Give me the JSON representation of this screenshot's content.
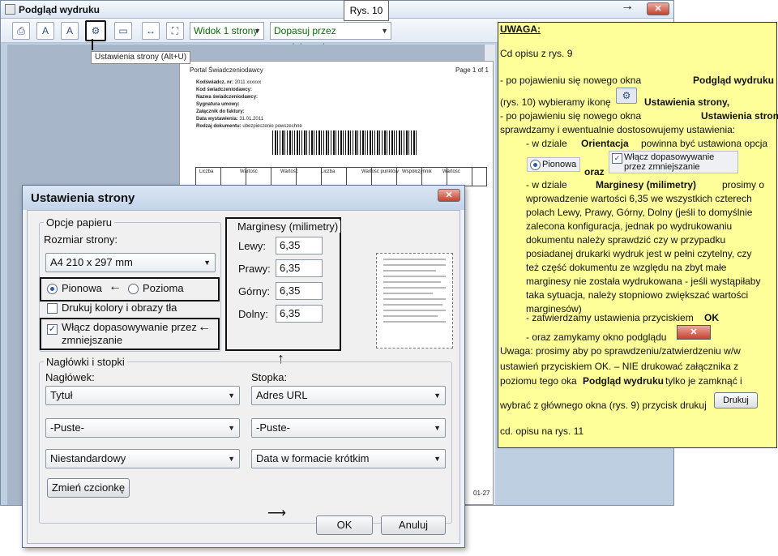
{
  "preview_window": {
    "title": "Podgląd wydruku",
    "close_glyph": "✕",
    "figure_label": "Rys. 10",
    "tooltip": "Ustawienia strony (Alt+U)",
    "toolbar": {
      "view_select": "Widok 1 strony",
      "fit_select": "Dopasuj przez zmniejszenie",
      "icons": [
        "printer-icon",
        "portrait-icon",
        "landscape-icon",
        "page-setup-icon",
        "header-footer-icon",
        "fit-width-icon",
        "fullscreen-icon"
      ]
    },
    "page": {
      "header_left": "Portal Świadczeniodawcy",
      "header_right": "Page 1 of 1",
      "fields": [
        {
          "label": "Kodświadcz. nr:",
          "value": "2011 xxxxxx"
        },
        {
          "label": "Kod świadczeniodawcy:",
          "value": ""
        },
        {
          "label": "Nazwa świadczeniodawcy:",
          "value": ""
        },
        {
          "label": "Sygnatura umowy:",
          "value": ""
        },
        {
          "label": "Załącznik do faktury:",
          "value": ""
        },
        {
          "label": "Data wystawienia:",
          "value": "31.01.2011"
        },
        {
          "label": "Rodzaj dokumentu:",
          "value": "ubezpieczenie powszechne"
        }
      ],
      "table_headers": [
        "Liczba",
        "Wartość",
        "Wartość",
        "Liczba",
        "Wartość punktów",
        "Współczynnik",
        "Wartość"
      ],
      "footer_fragment": "01-27",
      "side_values": [
        "1,00",
        "1,00",
        "1,00"
      ]
    }
  },
  "dialog": {
    "title": "Ustawienia strony",
    "close_glyph": "✕",
    "paper_options": {
      "legend": "Opcje papieru",
      "size_label": "Rozmiar strony:",
      "size_value": "A4 210 x 297 mm",
      "portrait": "Pionowa",
      "landscape": "Pozioma",
      "print_colors": "Drukuj kolory i obrazy tła",
      "shrink_to_fit_line1": "Włącz dopasowywanie przez",
      "shrink_to_fit_line2": "zmniejszanie"
    },
    "margins": {
      "legend": "Marginesy (milimetry)",
      "left_label": "Lewy:",
      "left_value": "6,35",
      "right_label": "Prawy:",
      "right_value": "6,35",
      "top_label": "Górny:",
      "top_value": "6,35",
      "bottom_label": "Dolny:",
      "bottom_value": "6,35"
    },
    "headers_footers": {
      "legend": "Nagłówki i stopki",
      "header_label": "Nagłówek:",
      "footer_label": "Stopka:",
      "header_values": [
        "Tytuł",
        "-Puste-",
        "Niestandardowy"
      ],
      "footer_values": [
        "Adres URL",
        "-Puste-",
        "Data w formacie krótkim"
      ],
      "font_button": "Zmień czcionkę"
    },
    "ok": "OK",
    "cancel": "Anuluj"
  },
  "note": {
    "heading": "UWAGA:",
    "lines": [
      "Cd opisu z rys. 9",
      "-      po pojawieniu się nowego okna",
      "Podgląd wydruku",
      "(rys. 10) wybieramy ikonę",
      "Ustawienia strony,",
      "-      po pojawieniu się nowego okna",
      "Ustawienia strony",
      "sprawdzamy i ewentualnie dostosowujemy ustawienia:",
      "- w dziale",
      "Orientacja",
      "powinna być ustawiona opcja",
      "oraz",
      "- w dziale",
      "Marginesy (milimetry)",
      "prosimy o",
      "wprowadzenie wartości 6,35 we wszystkich czterech",
      "polach Lewy, Prawy, Górny, Dolny (jeśli to domyślnie",
      "zalecona konfiguracja, jednak po wydrukowaniu",
      "dokumentu należy sprawdzić czy w przypadku",
      "posiadanej drukarki wydruk jest w pełni czytelny, czy",
      "też część dokumentu ze względu na zbyt małe",
      "marginesy nie została wydrukowana - jeśli wystąpiłaby",
      "taka sytuacja, należy stopniowo zwiększać wartości",
      "marginesów)",
      "- zatwierdzamy ustawienia przyciskiem",
      "OK",
      "- oraz zamykamy okno podglądu",
      "Uwaga: prosimy aby po sprawdzeniu/zatwierdzeniu w/w",
      "ustawień przyciskiem OK. – NIE drukować załącznika z",
      "poziomu tego oka",
      "Podgląd wydruku",
      "tylko je zamknąć i",
      "wybrać z głównego okna (rys. 9) przycisk drukuj",
      "cd. opisu na rys. 11"
    ],
    "mini_portrait": "Pionowa",
    "mini_shrink": "Włącz dopasowywanie przez zmniejszanie",
    "mini_print": "Drukuj"
  },
  "colors": {
    "note_bg": "#ffff99",
    "close_red": "#c7422f",
    "window_blue": "#bfcfe2"
  }
}
